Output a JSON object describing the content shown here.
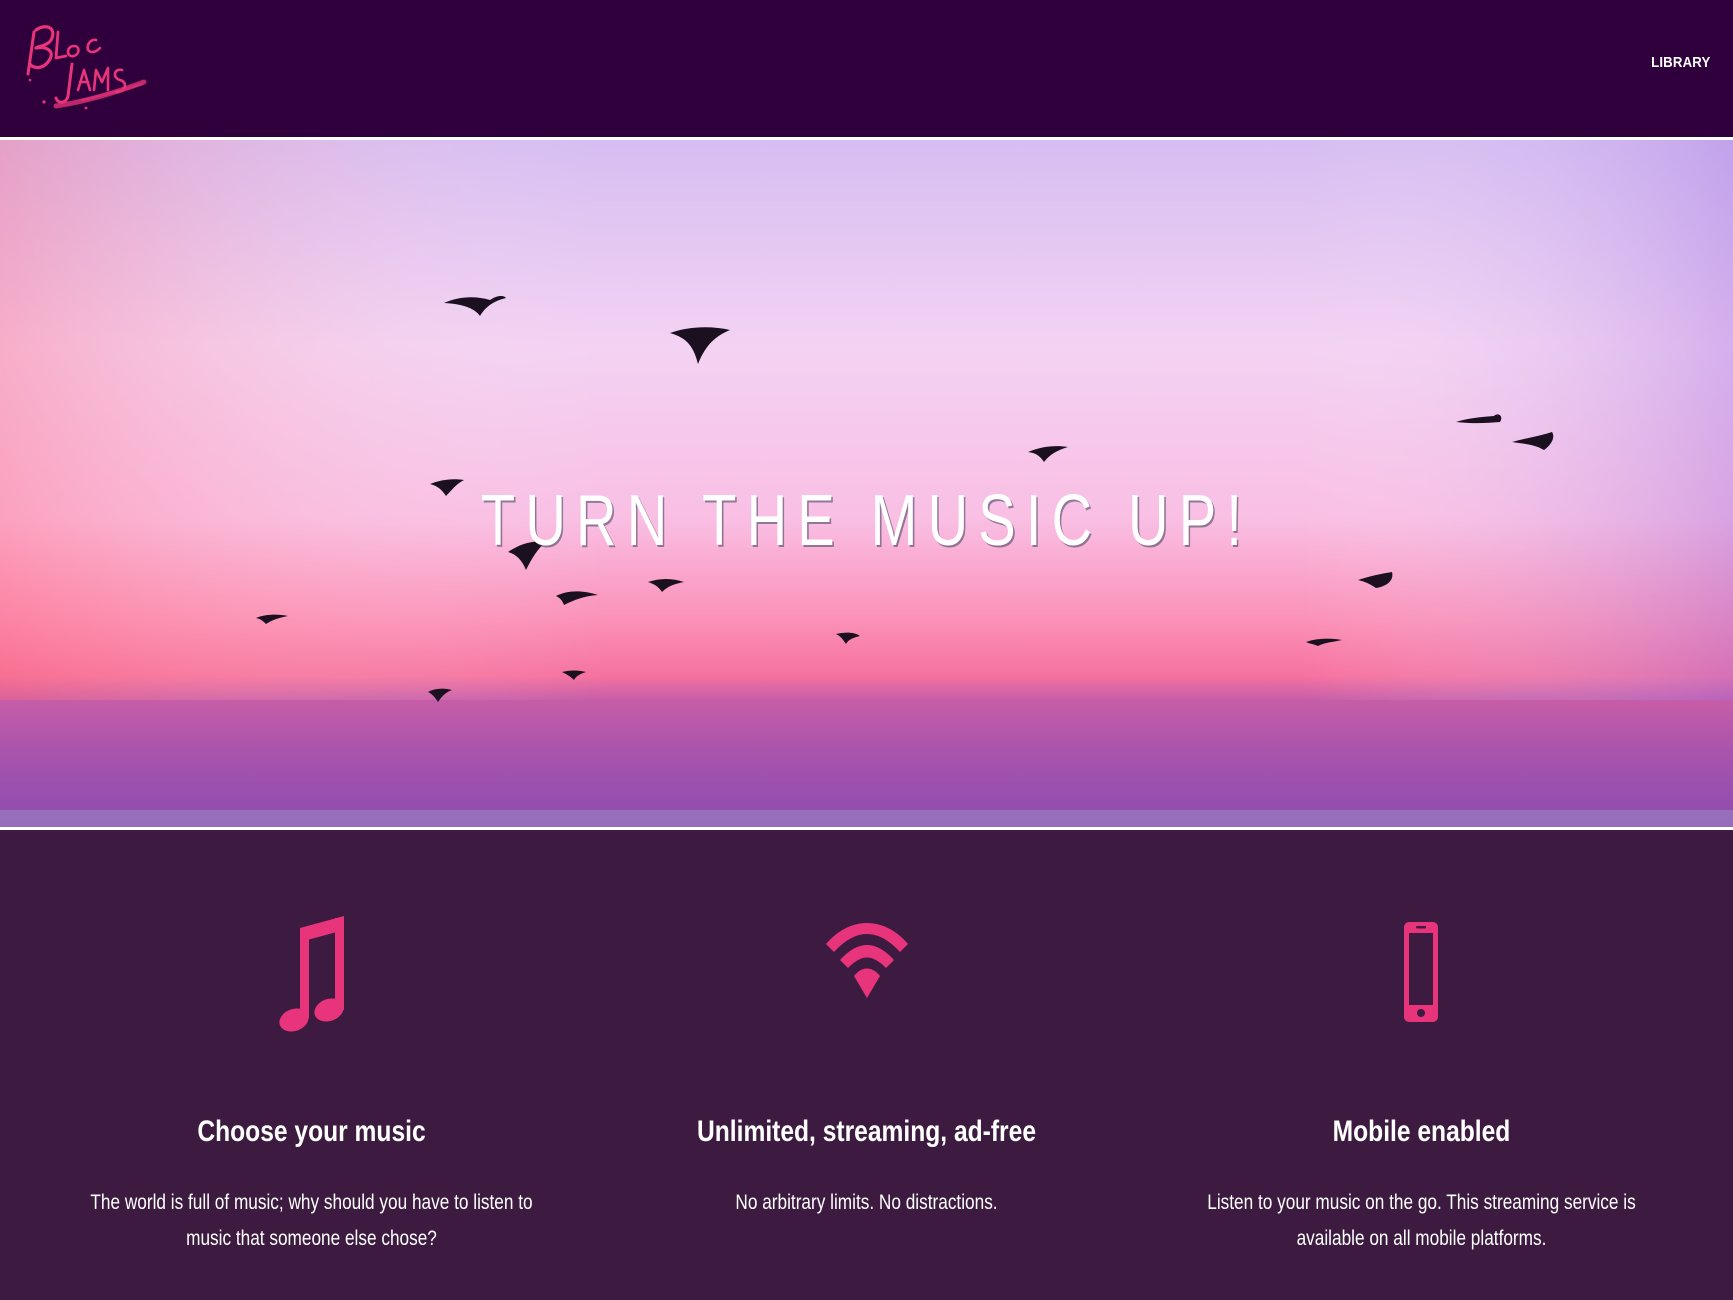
{
  "nav": {
    "logo_alt": "Bloc Jams",
    "library_label": "LIBRARY"
  },
  "hero": {
    "title": "TURN THE MUSIC UP!"
  },
  "colors": {
    "navbar": "#30003c",
    "section_bg": "#3d1b41",
    "accent_pink": "#e8347a",
    "text": "#ffffff"
  },
  "points": [
    {
      "icon": "music-note-icon",
      "title": "Choose your music",
      "text": "The world is full of music; why should you have to listen to music that someone else chose?"
    },
    {
      "icon": "wifi-icon",
      "title": "Unlimited, streaming, ad-free",
      "text": "No arbitrary limits. No distractions."
    },
    {
      "icon": "mobile-phone-icon",
      "title": "Mobile enabled",
      "text": "Listen to your music on the go. This streaming service is available on all mobile platforms."
    }
  ]
}
